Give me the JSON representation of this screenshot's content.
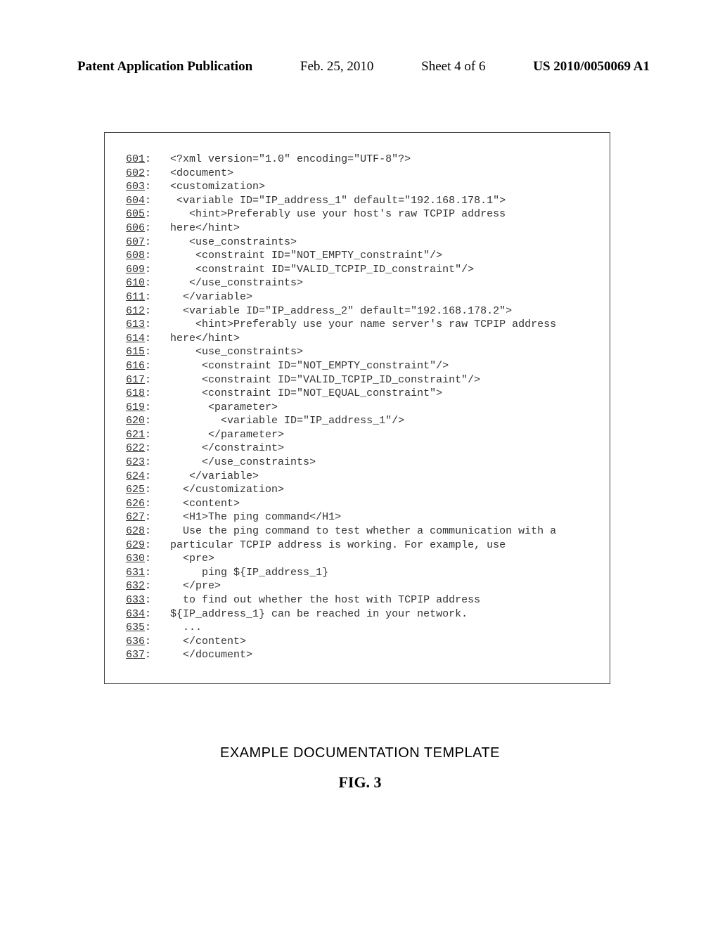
{
  "header": {
    "publication": "Patent Application Publication",
    "date": "Feb. 25, 2010",
    "sheet": "Sheet 4 of 6",
    "pubno": "US 2010/0050069 A1"
  },
  "code": {
    "lines": [
      {
        "n": "601",
        "t": "<?xml version=\"1.0\" encoding=\"UTF-8\"?>"
      },
      {
        "n": "602",
        "t": "<document>"
      },
      {
        "n": "603",
        "t": "<customization>"
      },
      {
        "n": "604",
        "t": " <variable ID=\"IP_address_1\" default=\"192.168.178.1\">"
      },
      {
        "n": "605",
        "t": "   <hint>Preferably use your host's raw TCPIP address"
      },
      {
        "n": "606",
        "t": "here</hint>"
      },
      {
        "n": "607",
        "t": "   <use_constraints>"
      },
      {
        "n": "608",
        "t": "    <constraint ID=\"NOT_EMPTY_constraint\"/>"
      },
      {
        "n": "609",
        "t": "    <constraint ID=\"VALID_TCPIP_ID_constraint\"/>"
      },
      {
        "n": "610",
        "t": "   </use_constraints>"
      },
      {
        "n": "611",
        "t": "  </variable>"
      },
      {
        "n": "612",
        "t": "  <variable ID=\"IP_address_2\" default=\"192.168.178.2\">"
      },
      {
        "n": "613",
        "t": "    <hint>Preferably use your name server's raw TCPIP address"
      },
      {
        "n": "614",
        "t": "here</hint>"
      },
      {
        "n": "615",
        "t": "    <use_constraints>"
      },
      {
        "n": "616",
        "t": "     <constraint ID=\"NOT_EMPTY_constraint\"/>"
      },
      {
        "n": "617",
        "t": "     <constraint ID=\"VALID_TCPIP_ID_constraint\"/>"
      },
      {
        "n": "618",
        "t": "     <constraint ID=\"NOT_EQUAL_constraint\">"
      },
      {
        "n": "619",
        "t": "      <parameter>"
      },
      {
        "n": "620",
        "t": "        <variable ID=\"IP_address_1\"/>"
      },
      {
        "n": "621",
        "t": "      </parameter>"
      },
      {
        "n": "622",
        "t": "     </constraint>"
      },
      {
        "n": "623",
        "t": "     </use_constraints>"
      },
      {
        "n": "624",
        "t": "   </variable>"
      },
      {
        "n": "625",
        "t": "  </customization>"
      },
      {
        "n": "626",
        "t": "  <content>"
      },
      {
        "n": "627",
        "t": "  <H1>The ping command</H1>"
      },
      {
        "n": "628",
        "t": "  Use the ping command to test whether a communication with a"
      },
      {
        "n": "629",
        "t": "particular TCPIP address is working. For example, use"
      },
      {
        "n": "630",
        "t": "  <pre>"
      },
      {
        "n": "631",
        "t": "     ping ${IP_address_1}"
      },
      {
        "n": "632",
        "t": "  </pre>"
      },
      {
        "n": "633",
        "t": "  to find out whether the host with TCPIP address"
      },
      {
        "n": "634",
        "t": "${IP_address_1} can be reached in your network."
      },
      {
        "n": "635",
        "t": "  ..."
      },
      {
        "n": "636",
        "t": "  </content>"
      },
      {
        "n": "637",
        "t": "  </document>"
      }
    ]
  },
  "caption": "EXAMPLE DOCUMENTATION TEMPLATE",
  "figure_label": "FIG. 3"
}
